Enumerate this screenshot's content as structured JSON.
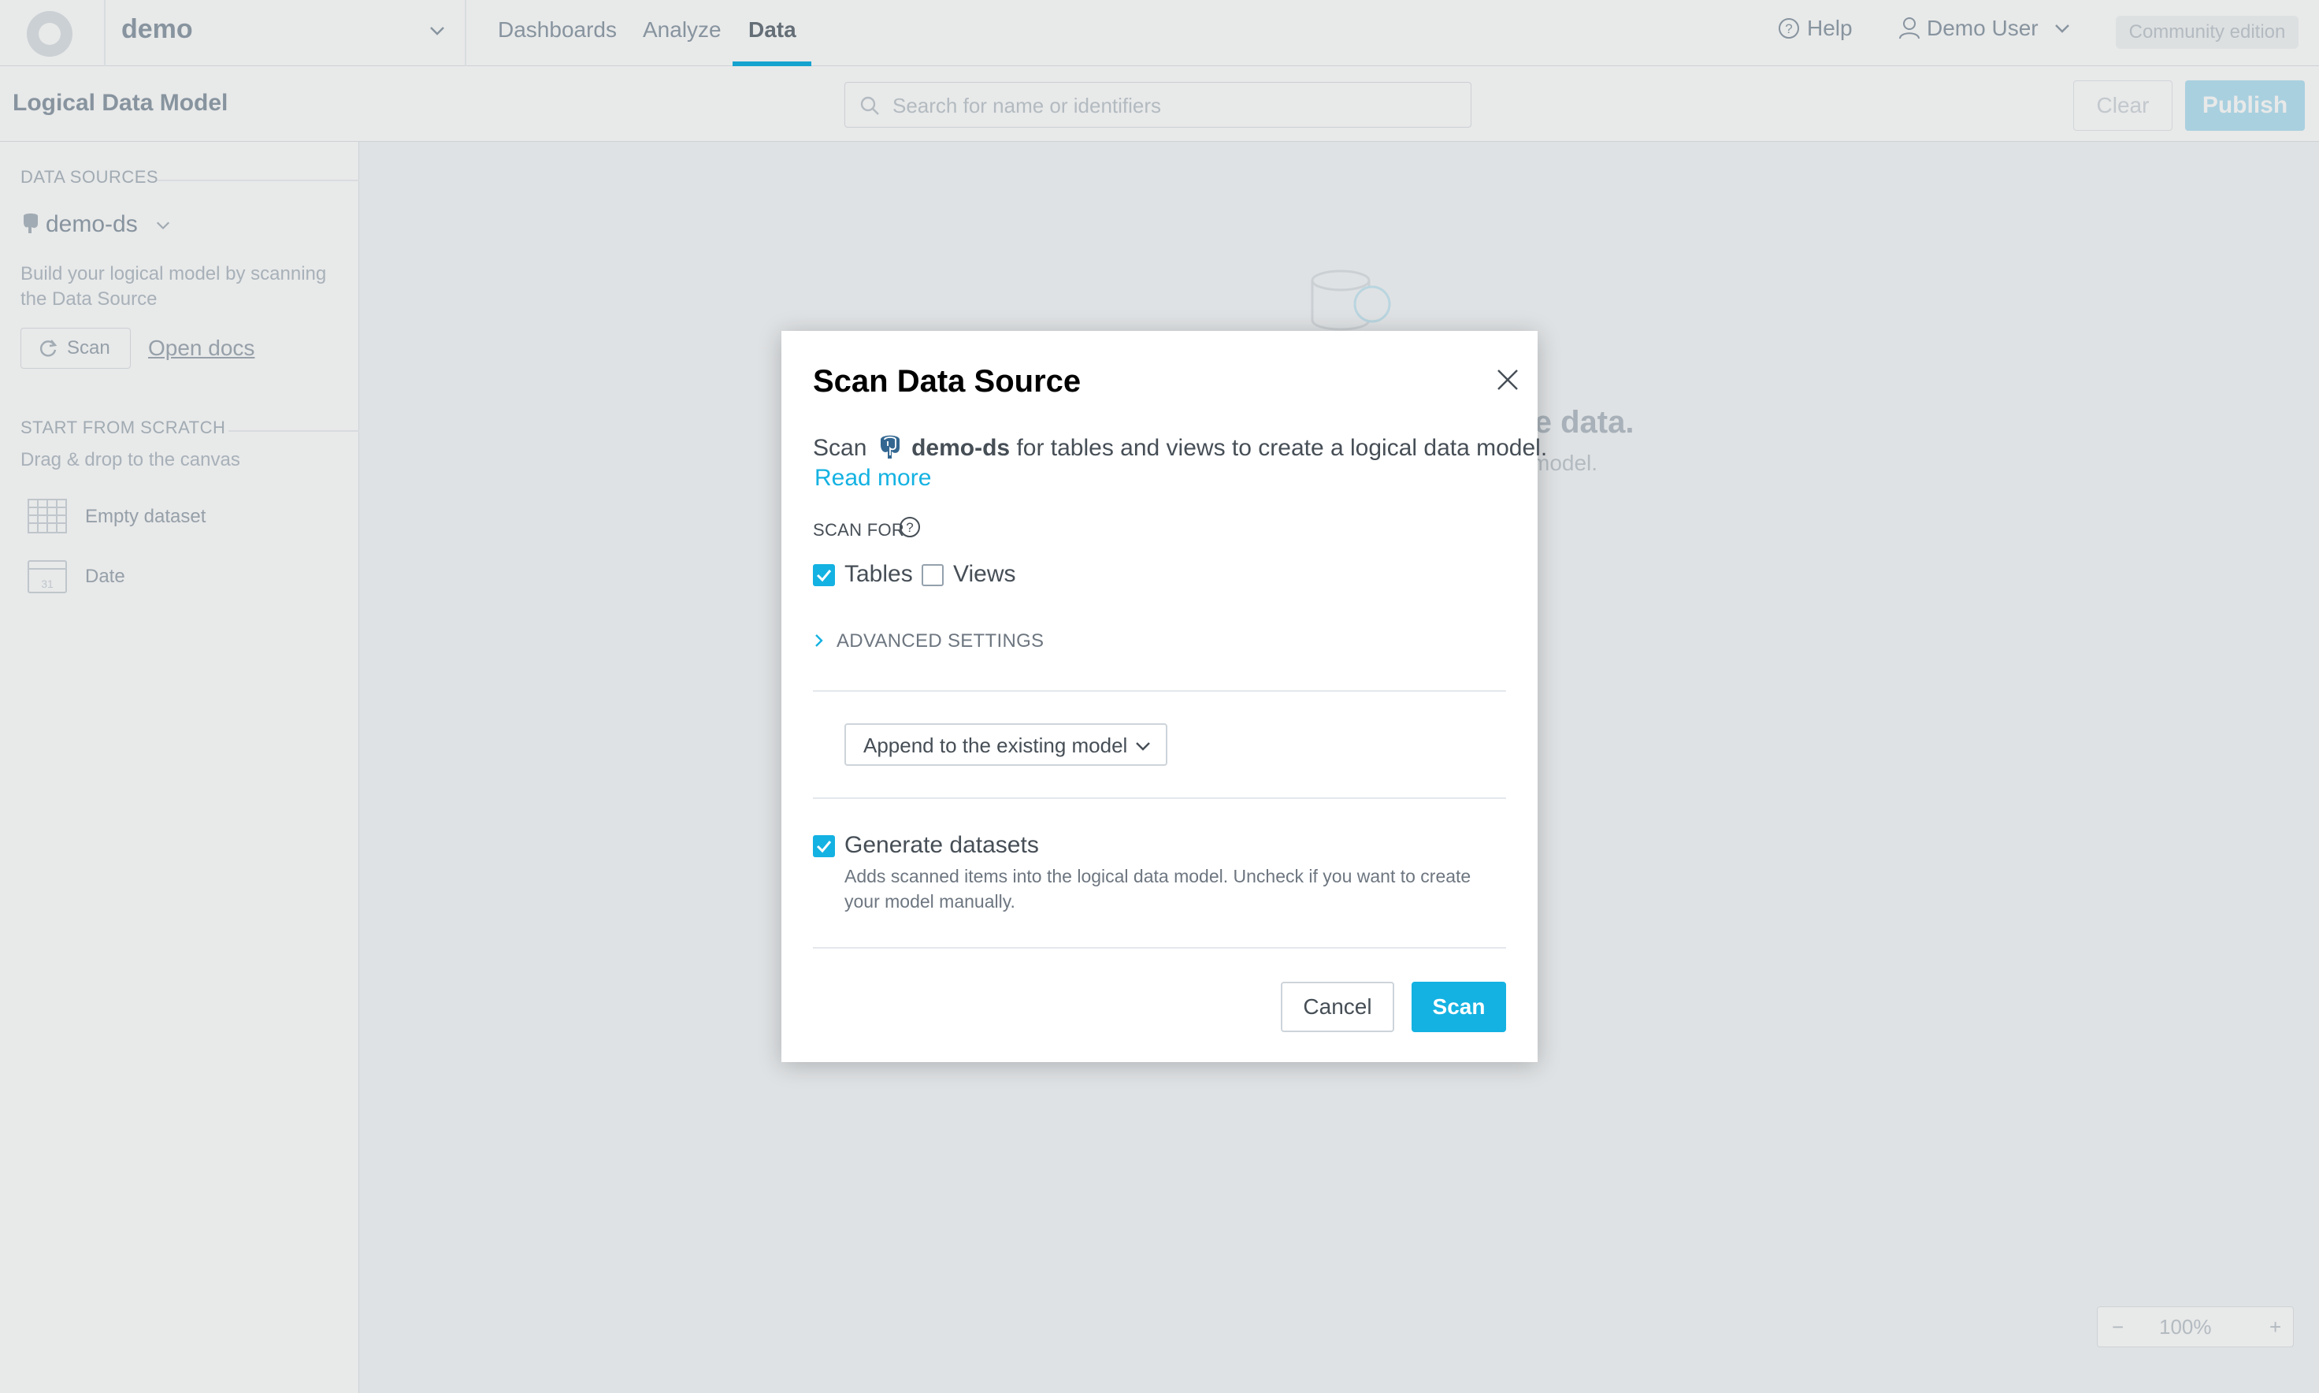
{
  "colors": {
    "accent": "#14b2e2",
    "text": "#464e56",
    "muted": "#94a1ad"
  },
  "topnav": {
    "workspace": "demo",
    "items": [
      {
        "label": "Dashboards",
        "active": false
      },
      {
        "label": "Analyze",
        "active": false
      },
      {
        "label": "Data",
        "active": true
      }
    ],
    "help": "Help",
    "user": "Demo User",
    "edition": "Community edition"
  },
  "subheader": {
    "title": "Logical Data Model",
    "search_placeholder": "Search for name or identifiers",
    "clear": "Clear",
    "publish": "Publish"
  },
  "sidebar": {
    "data_sources_heading": "DATA SOURCES",
    "data_source": "demo-ds",
    "description": "Build your logical model by scanning the Data Source",
    "scan": "Scan",
    "open_docs": "Open docs",
    "scratch_heading": "START FROM SCRATCH",
    "drag_hint": "Drag & drop to the canvas",
    "items": [
      {
        "label": "Empty dataset",
        "icon": "table-icon"
      },
      {
        "label": "Date",
        "icon": "calendar-icon"
      }
    ]
  },
  "canvas": {
    "empty_title": "the data.",
    "empty_sub": "model.",
    "zoom": {
      "minus": "−",
      "level": "100%",
      "plus": "+"
    }
  },
  "dialog": {
    "title": "Scan Data Source",
    "desc_prefix": "Scan",
    "datasource": "demo-ds",
    "desc_suffix": "for tables and views to create a logical data model.",
    "read_more": "Read more",
    "scan_for": "SCAN FOR",
    "options": [
      {
        "label": "Tables",
        "checked": true
      },
      {
        "label": "Views",
        "checked": false
      }
    ],
    "advanced": "ADVANCED SETTINGS",
    "mode_select": "Append to the existing model",
    "generate": {
      "label": "Generate datasets",
      "checked": true,
      "description": "Adds scanned items into the logical data model. Uncheck if you want to create your model manually."
    },
    "cancel": "Cancel",
    "scan": "Scan"
  }
}
